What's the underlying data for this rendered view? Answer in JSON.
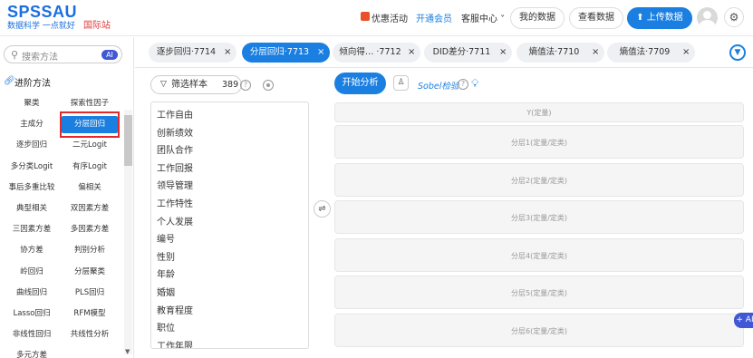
{
  "header": {
    "logo": "SPSSAU",
    "slogan": "数据科学 一点就好",
    "intl": "国际站",
    "promo": "优惠活动",
    "vip": "开通会员",
    "service": "客服中心 ˅",
    "my_data": "我的数据",
    "view_data": "查看数据",
    "upload": "上传数据"
  },
  "sidebar": {
    "search_placeholder": "搜索方法",
    "ai_badge": "AI",
    "section_title": "进阶方法",
    "methods": [
      [
        "聚类",
        "探索性因子"
      ],
      [
        "主成分",
        "分层回归"
      ],
      [
        "逐步回归",
        "二元Logit"
      ],
      [
        "多分类Logit",
        "有序Logit"
      ],
      [
        "事后多重比较",
        "偏相关"
      ],
      [
        "典型相关",
        "双因素方差"
      ],
      [
        "三因素方差",
        "多因素方差"
      ],
      [
        "协方差",
        "判别分析"
      ],
      [
        "岭回归",
        "分层聚类"
      ],
      [
        "曲线回归",
        "PLS回归"
      ],
      [
        "Lasso回归",
        "RFM模型"
      ],
      [
        "非线性回归",
        "共线性分析"
      ],
      [
        "多元方差",
        ""
      ]
    ]
  },
  "tabs": [
    {
      "label": "逐步回归·7714",
      "close": "×"
    },
    {
      "label": "分层回归·7713",
      "close": "×"
    },
    {
      "label": "倾向得… ·7712",
      "close": "×"
    },
    {
      "label": "DID差分·7711",
      "close": "×"
    },
    {
      "label": "熵值法·7710",
      "close": "×"
    },
    {
      "label": "熵值法·7709",
      "close": "×"
    }
  ],
  "filter": {
    "label": "筛选样本",
    "count": "389"
  },
  "variables": [
    "工作自由",
    "创新绩效",
    "团队合作",
    "工作回报",
    "领导管理",
    "工作特性",
    "个人发展",
    "编号",
    "性别",
    "年龄",
    "婚姻",
    "教育程度",
    "职位",
    "工作年限"
  ],
  "analysis": {
    "start": "开始分析",
    "sobel": "Sobel检验",
    "dropzones": [
      "Y(定量)",
      "分层1(定量/定类)",
      "分层2(定量/定类)",
      "分层3(定量/定类)",
      "分层4(定量/定类)",
      "分层5(定量/定类)",
      "分层6(定量/定类)"
    ]
  },
  "ai_float": "+ AI",
  "colors": {
    "primary": "#1a7fe0",
    "highlight": "#e22a2a",
    "ai": "#4057d6"
  }
}
